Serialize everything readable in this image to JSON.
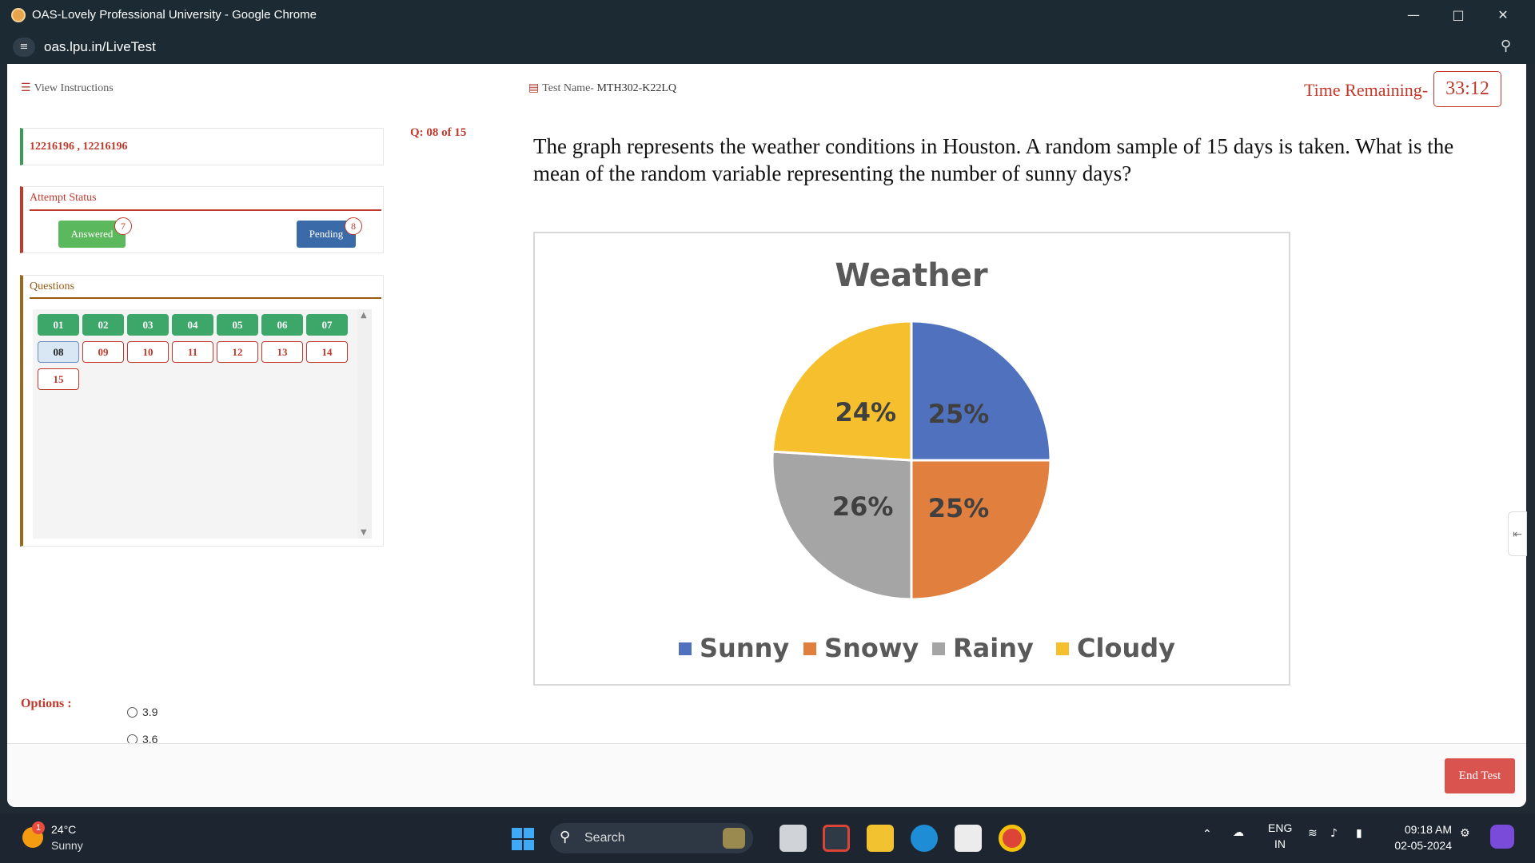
{
  "browser": {
    "title": "OAS-Lovely Professional University - Google Chrome",
    "url": "oas.lpu.in/LiveTest"
  },
  "header": {
    "view_instructions": "View Instructions",
    "test_name_label": "Test Name-",
    "test_name": "MTH302-K22LQ",
    "time_label": "Time Remaining-",
    "time_value": "33:12"
  },
  "candidate": {
    "ids": "12216196 , 12216196"
  },
  "attempt_status": {
    "heading": "Attempt Status",
    "answered_label": "Answered",
    "answered_count": "7",
    "pending_label": "Pending",
    "pending_count": "8"
  },
  "questions_panel": {
    "heading": "Questions",
    "items": [
      {
        "n": "01",
        "state": "answered"
      },
      {
        "n": "02",
        "state": "answered"
      },
      {
        "n": "03",
        "state": "answered"
      },
      {
        "n": "04",
        "state": "answered"
      },
      {
        "n": "05",
        "state": "answered"
      },
      {
        "n": "06",
        "state": "answered"
      },
      {
        "n": "07",
        "state": "answered"
      },
      {
        "n": "08",
        "state": "current"
      },
      {
        "n": "09",
        "state": "pending"
      },
      {
        "n": "10",
        "state": "pending"
      },
      {
        "n": "11",
        "state": "pending"
      },
      {
        "n": "12",
        "state": "pending"
      },
      {
        "n": "13",
        "state": "pending"
      },
      {
        "n": "14",
        "state": "pending"
      },
      {
        "n": "15",
        "state": "pending"
      }
    ]
  },
  "question": {
    "number_label": "Q: 08 of 15",
    "text": "The graph represents the weather conditions in Houston. A random sample of 15 days is taken. What is the mean of the random variable representing the number of sunny days?"
  },
  "chart_data": {
    "type": "pie",
    "title": "Weather",
    "categories": [
      "Sunny",
      "Snowy",
      "Rainy",
      "Cloudy"
    ],
    "values": [
      25,
      25,
      26,
      24
    ],
    "labels": [
      "25%",
      "25%",
      "26%",
      "24%"
    ],
    "colors": [
      "#4f71be",
      "#e07f3e",
      "#a5a5a5",
      "#f6bf2e"
    ],
    "legend_position": "bottom"
  },
  "options": {
    "label": "Options :",
    "items": [
      "3.9",
      "3.6"
    ]
  },
  "footer": {
    "end_test": "End Test"
  },
  "taskbar": {
    "temperature": "24°C",
    "weather": "Sunny",
    "weather_badge": "1",
    "search": "Search",
    "lang1": "ENG",
    "lang2": "IN",
    "time": "09:18 AM",
    "date": "02-05-2024"
  }
}
